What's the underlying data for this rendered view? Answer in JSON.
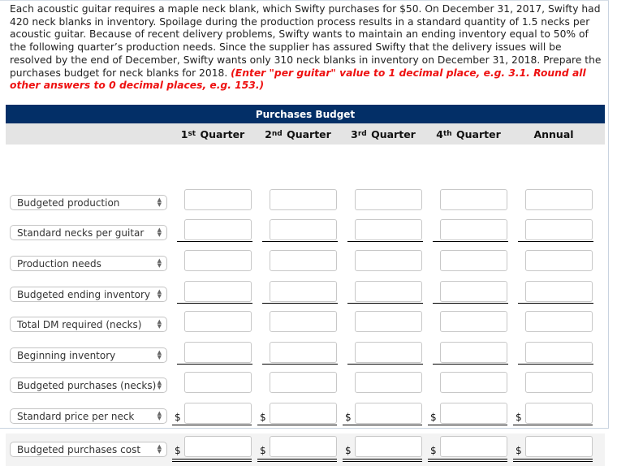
{
  "question": {
    "text": "Each acoustic guitar requires a maple neck blank, which Swifty purchases for $50. On December 31, 2017, Swifty had 420 neck blanks in inventory. Spoilage during the production process results in a standard quantity of 1.5 necks per acoustic guitar. Because of recent delivery problems, Swifty wants to maintain an ending inventory equal to 50% of the following quarter’s production needs. Since the supplier has assured Swifty that the delivery issues will be resolved by the end of December, Swifty wants only 310 neck blanks in inventory on December 31, 2018. Prepare the purchases budget for neck blanks for 2018.",
    "instructions": "(Enter \"per guitar\" value to 1 decimal place, e.g. 3.1. Round all other answers to 0 decimal places, e.g. 153.)"
  },
  "table": {
    "title": "Purchases Budget",
    "columns": [
      {
        "num": "1",
        "sup": "st",
        "label": "Quarter"
      },
      {
        "num": "2",
        "sup": "nd",
        "label": "Quarter"
      },
      {
        "num": "3",
        "sup": "rd",
        "label": "Quarter"
      },
      {
        "num": "4",
        "sup": "th",
        "label": "Quarter"
      },
      {
        "num": "",
        "sup": "",
        "label": "Annual"
      }
    ],
    "currency_symbol": "$",
    "rows": [
      {
        "label": "Budgeted production",
        "values": [
          "",
          "",
          "",
          "",
          ""
        ],
        "dollar": false,
        "underline": "none"
      },
      {
        "label": "Standard necks per guitar",
        "values": [
          "",
          "",
          "",
          "",
          ""
        ],
        "dollar": false,
        "underline": "single"
      },
      {
        "label": "Production needs",
        "values": [
          "",
          "",
          "",
          "",
          ""
        ],
        "dollar": false,
        "underline": "none"
      },
      {
        "label": "Budgeted ending inventory",
        "values": [
          "",
          "",
          "",
          "",
          ""
        ],
        "dollar": false,
        "underline": "single"
      },
      {
        "label": "Total DM required (necks)",
        "values": [
          "",
          "",
          "",
          "",
          ""
        ],
        "dollar": false,
        "underline": "none"
      },
      {
        "label": "Beginning inventory",
        "values": [
          "",
          "",
          "",
          "",
          ""
        ],
        "dollar": false,
        "underline": "single"
      },
      {
        "label": "Budgeted purchases (necks)",
        "values": [
          "",
          "",
          "",
          "",
          ""
        ],
        "dollar": false,
        "underline": "none"
      },
      {
        "label": "Standard price per neck",
        "values": [
          "",
          "",
          "",
          "",
          ""
        ],
        "dollar": true,
        "underline": "single"
      },
      {
        "label": "Budgeted purchases cost",
        "values": [
          "",
          "",
          "",
          "",
          ""
        ],
        "dollar": true,
        "underline": "double"
      }
    ]
  }
}
